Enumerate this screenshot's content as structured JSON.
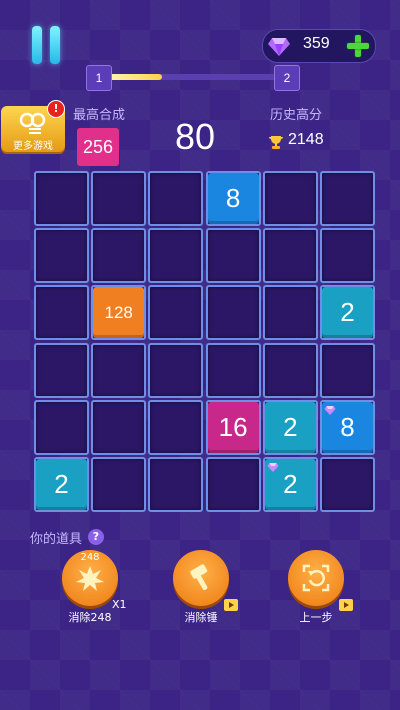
{
  "header": {
    "gems": "359",
    "level_current": "1",
    "level_next": "2",
    "level_progress": 0.32
  },
  "more_games": {
    "label": "更多游戏",
    "badge": "!"
  },
  "stats": {
    "best_merge_label": "最高合成",
    "best_merge_value": "256",
    "score": "80",
    "history_label": "历史高分",
    "history_value": "2148"
  },
  "board": {
    "rows": 6,
    "cols": 6,
    "tiles": [
      {
        "row": 0,
        "col": 3,
        "value": "8",
        "color": "#1a86e0",
        "gem": false
      },
      {
        "row": 2,
        "col": 1,
        "value": "128",
        "color": "#f07f22",
        "gem": false
      },
      {
        "row": 2,
        "col": 5,
        "value": "2",
        "color": "#19a0c2",
        "gem": false
      },
      {
        "row": 4,
        "col": 3,
        "value": "16",
        "color": "#c8288a",
        "gem": false
      },
      {
        "row": 4,
        "col": 4,
        "value": "2",
        "color": "#19a0c2",
        "gem": false
      },
      {
        "row": 4,
        "col": 5,
        "value": "8",
        "color": "#1a86e0",
        "gem": true
      },
      {
        "row": 5,
        "col": 0,
        "value": "2",
        "color": "#19a0c2",
        "gem": false
      },
      {
        "row": 5,
        "col": 4,
        "value": "2",
        "color": "#19a0c2",
        "gem": true
      }
    ]
  },
  "tools": {
    "title": "你的道具",
    "help": "?",
    "items": [
      {
        "name": "eliminate-248",
        "label": "消除248",
        "badge_text": "248",
        "count": "X1"
      },
      {
        "name": "hammer",
        "label": "消除锤"
      },
      {
        "name": "undo",
        "label": "上一步"
      }
    ]
  },
  "colors": {
    "background": "#3b2486",
    "cell_fill": "#2b1766",
    "cell_border": "#6f8fe6",
    "accent_orange": "#ec7a10",
    "gem_purple": "#b469ff",
    "plus_green": "#4bd83a"
  }
}
